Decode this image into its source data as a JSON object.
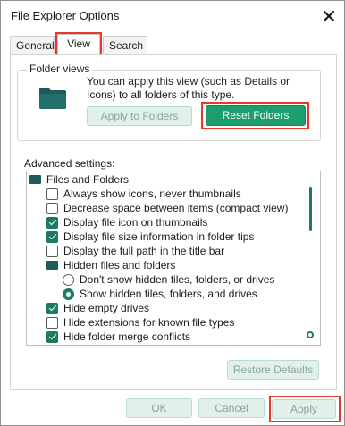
{
  "window": {
    "title": "File Explorer Options"
  },
  "tabs": [
    {
      "label": "General",
      "active": false
    },
    {
      "label": "View",
      "active": true
    },
    {
      "label": "Search",
      "active": false
    }
  ],
  "folder_views": {
    "legend": "Folder views",
    "description": "You can apply this view (such as Details or Icons) to all folders of this type.",
    "apply_to_folders_label": "Apply to Folders",
    "reset_folders_label": "Reset Folders"
  },
  "advanced": {
    "label": "Advanced settings:",
    "items": [
      {
        "type": "folder",
        "label": "Files and Folders",
        "indent": 0
      },
      {
        "type": "checkbox",
        "label": "Always show icons, never thumbnails",
        "checked": false,
        "indent": 1
      },
      {
        "type": "checkbox",
        "label": "Decrease space between items (compact view)",
        "checked": false,
        "indent": 1
      },
      {
        "type": "checkbox",
        "label": "Display file icon on thumbnails",
        "checked": true,
        "indent": 1
      },
      {
        "type": "checkbox",
        "label": "Display file size information in folder tips",
        "checked": true,
        "indent": 1
      },
      {
        "type": "checkbox",
        "label": "Display the full path in the title bar",
        "checked": false,
        "indent": 1
      },
      {
        "type": "folder",
        "label": "Hidden files and folders",
        "indent": 1
      },
      {
        "type": "radio",
        "label": "Don't show hidden files, folders, or drives",
        "checked": false,
        "indent": 2
      },
      {
        "type": "radio",
        "label": "Show hidden files, folders, and drives",
        "checked": true,
        "indent": 2
      },
      {
        "type": "checkbox",
        "label": "Hide empty drives",
        "checked": true,
        "indent": 1
      },
      {
        "type": "checkbox",
        "label": "Hide extensions for known file types",
        "checked": false,
        "indent": 1
      },
      {
        "type": "checkbox",
        "label": "Hide folder merge conflicts",
        "checked": true,
        "indent": 1
      }
    ],
    "restore_defaults_label": "Restore Defaults"
  },
  "footer": {
    "ok_label": "OK",
    "cancel_label": "Cancel",
    "apply_label": "Apply"
  },
  "colors": {
    "accent": "#1e9e6e",
    "accent_dark": "#1d7a63",
    "highlight": "#e6392b",
    "folder": "#1d5c58"
  }
}
